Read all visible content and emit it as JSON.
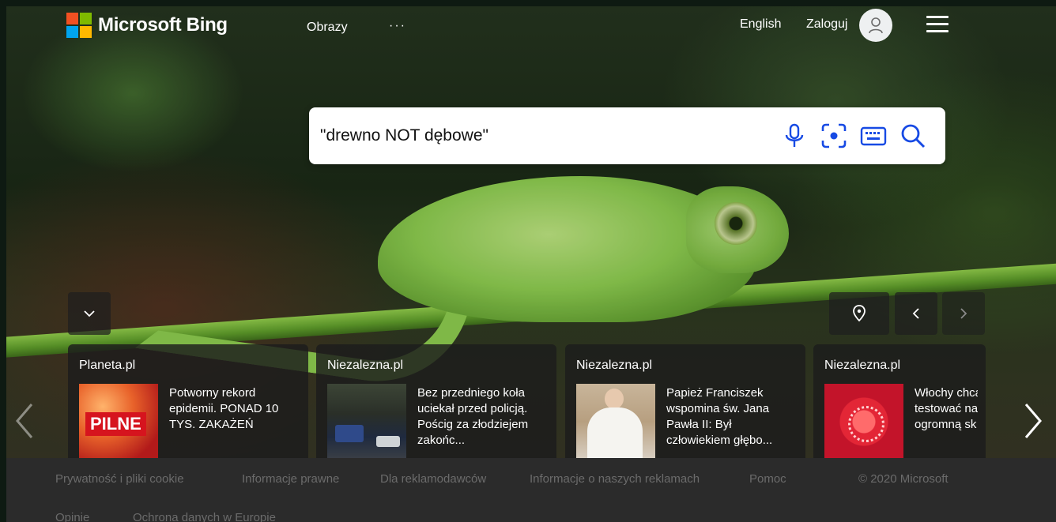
{
  "header": {
    "brand": "Microsoft Bing",
    "logo_colors": [
      "#f25022",
      "#7fba00",
      "#00a4ef",
      "#ffb900"
    ],
    "nav_images": "Obrazy",
    "nav_more": "···",
    "language": "English",
    "sign_in": "Zaloguj",
    "avatar_icon": "person-icon",
    "menu_icon": "hamburger-menu-icon"
  },
  "search": {
    "value": "\"drewno NOT dębowe\"",
    "icons": [
      "microphone-icon",
      "visual-search-icon",
      "keyboard-icon",
      "search-icon"
    ],
    "accent_color": "#174ae4"
  },
  "controls": {
    "collapse_icon": "chevron-down-icon",
    "location_icon": "location-pin-icon",
    "prev_icon": "chevron-left-icon",
    "next_icon": "chevron-right-icon"
  },
  "news": [
    {
      "source": "Planeta.pl",
      "headline": "Potworny rekord\nepidemii. PONAD 10\nTYS. ZAKAŻEŃ",
      "thumb_text": "PILNE"
    },
    {
      "source": "Niezalezna.pl",
      "headline": "Bez przedniego koła\nuciekał przed policją.\nPościg za złodziejem\nzakońc..."
    },
    {
      "source": "Niezalezna.pl",
      "headline": "Papież Franciszek\nwspomina św. Jana\nPawła II: Był\nczłowiekiem głębo..."
    },
    {
      "source": "Niezalezna.pl",
      "headline": "Włochy chcą\ntestować na\nogromną sk"
    }
  ],
  "footer": {
    "links": [
      "Prywatność i pliki cookie",
      "Informacje prawne",
      "Dla reklamodawców",
      "Informacje o naszych reklamach",
      "Pomoc",
      "Opinie",
      "Ochrona danych w Europie"
    ],
    "copyright": "© 2020 Microsoft"
  }
}
